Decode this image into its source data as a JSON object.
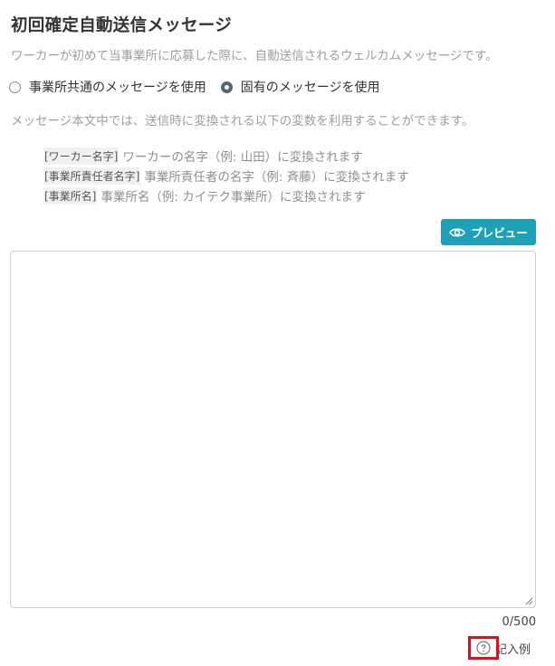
{
  "header": {
    "title": "初回確定自動送信メッセージ",
    "description": "ワーカーが初めて当事業所に応募した際に、自動送信されるウェルカムメッセージです。"
  },
  "message_type": {
    "options": [
      {
        "label": "事業所共通のメッセージを使用",
        "checked": false
      },
      {
        "label": "固有のメッセージを使用",
        "checked": true
      }
    ]
  },
  "variables": {
    "intro": "メッセージ本文中では、送信時に変換される以下の変数を利用することができます。",
    "items": [
      {
        "tag": "[ワーカー名字]",
        "text": "ワーカーの名字（例: 山田）に変換されます"
      },
      {
        "tag": "[事業所責任者名字]",
        "text": "事業所責任者の名字（例: 斉藤）に変換されます"
      },
      {
        "tag": "[事業所名]",
        "text": "事業所名（例: カイテク事業所）に変換されます"
      }
    ]
  },
  "preview": {
    "label": "プレビュー",
    "icon": "eye-icon"
  },
  "editor": {
    "value": "",
    "counter": "0/500"
  },
  "example": {
    "label": "記入例",
    "icon": "question-circle-icon",
    "highlight_color": "#e0101a"
  },
  "colors": {
    "accent": "#1ea1b6"
  }
}
